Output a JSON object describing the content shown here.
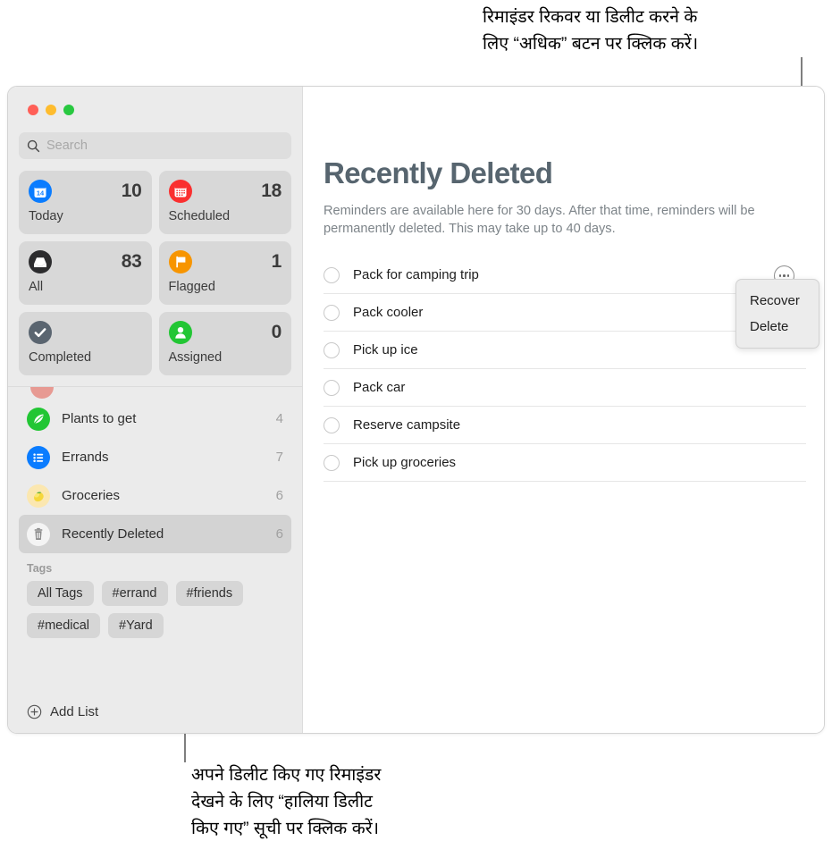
{
  "callouts": {
    "top": "रिमाइंडर रिकवर या डिलीट करने के\nलिए “अधिक” बटन पर क्लिक करें।",
    "bottom": "अपने डिलीट किए गए रिमाइंडर\nदेखने के लिए “हालिया डिलीट\nकिए गए” सूची पर क्लिक करें।"
  },
  "window": {
    "traffic_lights": {
      "close_color": "#ff5f57",
      "minimize_color": "#febc2e",
      "zoom_color": "#28c840"
    }
  },
  "sidebar": {
    "search": {
      "placeholder": "Search",
      "value": ""
    },
    "smart_lists": [
      {
        "label": "Today",
        "count": "10",
        "icon": "calendar-day-icon",
        "color": "#0a7cff"
      },
      {
        "label": "Scheduled",
        "count": "18",
        "icon": "calendar-grid-icon",
        "color": "#fa2f2f"
      },
      {
        "label": "All",
        "count": "83",
        "icon": "inbox-tray-icon",
        "color": "#2c2c2e"
      },
      {
        "label": "Flagged",
        "count": "1",
        "icon": "flag-icon",
        "color": "#f79500"
      },
      {
        "label": "Completed",
        "count": "",
        "icon": "checkmark-icon",
        "color": "#5a6570"
      },
      {
        "label": "Assigned",
        "count": "0",
        "icon": "person-icon",
        "color": "#22c634"
      }
    ],
    "my_lists": [
      {
        "label": "Plants to get",
        "count": "4",
        "icon": "leaf-icon",
        "color": "#22c634",
        "selected": false
      },
      {
        "label": "Errands",
        "count": "7",
        "icon": "list-icon",
        "color": "#0a7cff",
        "selected": false
      },
      {
        "label": "Groceries",
        "count": "6",
        "icon": "lemon-icon",
        "color": "#fbe7b0",
        "selected": false
      },
      {
        "label": "Recently Deleted",
        "count": "6",
        "icon": "trash-icon",
        "color": "#f2f2f2",
        "selected": true
      }
    ],
    "tags": {
      "header": "Tags",
      "chips": [
        "All Tags",
        "#errand",
        "#friends",
        "#medical",
        "#Yard"
      ]
    },
    "add_list": {
      "label": "Add List",
      "icon": "plus-circle-icon"
    }
  },
  "main": {
    "title": "Recently Deleted",
    "description": "Reminders are available here for 30 days. After that time, reminders will be permanently deleted. This may take up to 40 days.",
    "reminders": [
      "Pack for camping trip",
      "Pack cooler",
      "Pick up ice",
      "Pack car",
      "Reserve campsite",
      "Pick up groceries"
    ],
    "more_button": {
      "icon": "ellipsis-circle-icon"
    },
    "context_menu": {
      "items": [
        "Recover",
        "Delete"
      ]
    }
  }
}
